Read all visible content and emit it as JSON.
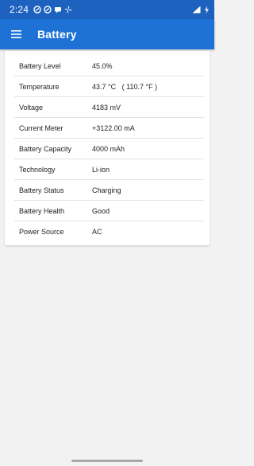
{
  "status_bar": {
    "time": "2:24",
    "left_icons": [
      "sync-icon",
      "sync-icon",
      "message-icon",
      "fan-icon"
    ],
    "right_icons": [
      "signal-icon",
      "battery-charging-icon"
    ]
  },
  "app_bar": {
    "menu_icon": "menu-icon",
    "title": "Battery"
  },
  "battery_info": {
    "rows": [
      {
        "label": "Battery Level",
        "value": "45.0%"
      },
      {
        "label": "Temperature",
        "value": "43.7 °C   ( 110.7 °F )"
      },
      {
        "label": "Voltage",
        "value": "4183 mV"
      },
      {
        "label": "Current Meter",
        "value": "+3122.00 mA"
      },
      {
        "label": "Battery Capacity",
        "value": "4000 mAh"
      },
      {
        "label": "Technology",
        "value": "Li-ion"
      },
      {
        "label": "Battery Status",
        "value": "Charging"
      },
      {
        "label": "Battery Health",
        "value": "Good"
      },
      {
        "label": "Power Source",
        "value": "AC"
      }
    ]
  },
  "colors": {
    "status_bar": "#1d62bf",
    "app_bar": "#1e72d6",
    "background": "#f2f2f2",
    "card": "#ffffff"
  }
}
